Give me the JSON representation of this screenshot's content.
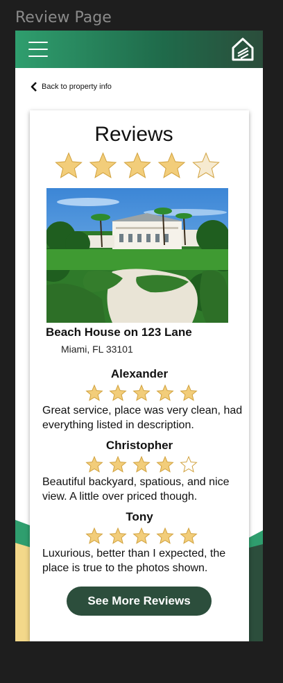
{
  "frame_label": "Review Page",
  "colors": {
    "brand_green": "#2f9e6e",
    "dark_green": "#2c4e3c",
    "star_fill": "#f2cd7a",
    "star_stroke": "#d1a23f",
    "accent_yellow": "#f3d88a"
  },
  "nav": {
    "menu_icon": "hamburger-menu-icon",
    "home_icon": "home-icon",
    "back_label": "Back to property info"
  },
  "card": {
    "title": "Reviews",
    "overall_rating": 4.5,
    "property_name": "Beach House on 123 Lane",
    "property_address": "Miami, FL 33101"
  },
  "reviews": [
    {
      "name": "Alexander",
      "rating": 5,
      "text": "Great service, place was very clean, had everything listed in description."
    },
    {
      "name": "Christopher",
      "rating": 4,
      "text": "Beautiful backyard, spatious, and nice view. A little over priced though."
    },
    {
      "name": "Tony",
      "rating": 5,
      "text": "Luxurious, better than I expected, the place is true to the photos shown."
    }
  ],
  "more_button": "See More Reviews"
}
